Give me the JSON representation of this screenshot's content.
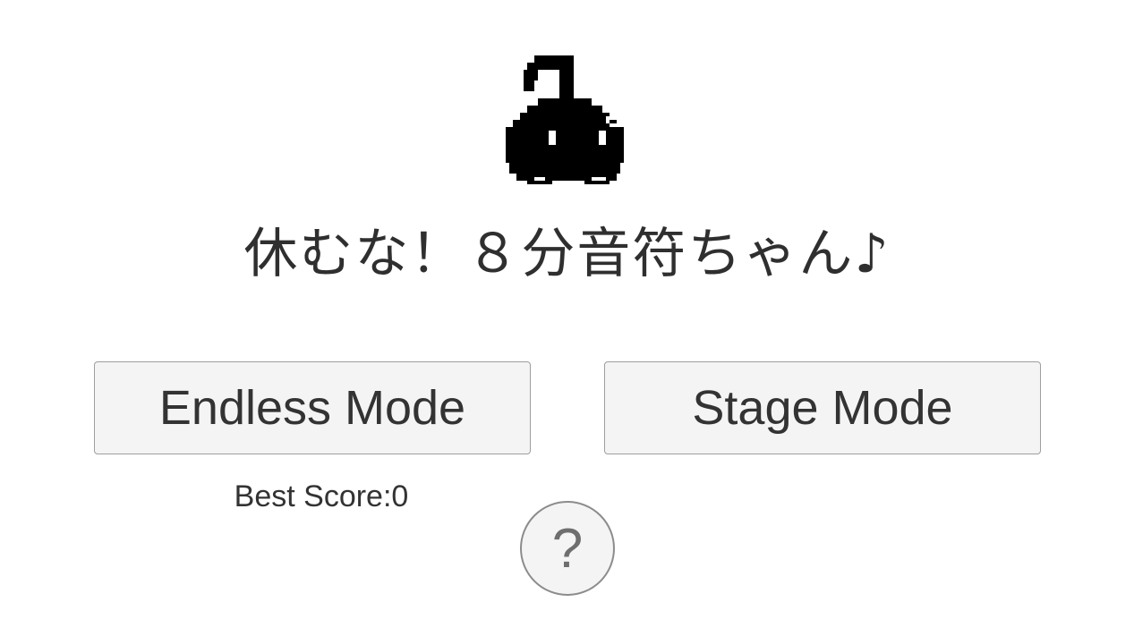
{
  "title": "休むな！８分音符ちゃん♪",
  "mascot": {
    "icon": "eighth-note-character-icon",
    "color": "#000000",
    "eye_color": "#ffffff"
  },
  "buttons": {
    "endless_label": "Endless Mode",
    "stage_label": "Stage Mode",
    "help_label": "?"
  },
  "best_score": {
    "text": "Best Score:0"
  },
  "colors": {
    "background": "#ffffff",
    "text": "#333333",
    "button_face": "#f4f4f4",
    "button_border": "#9e9e9e"
  }
}
